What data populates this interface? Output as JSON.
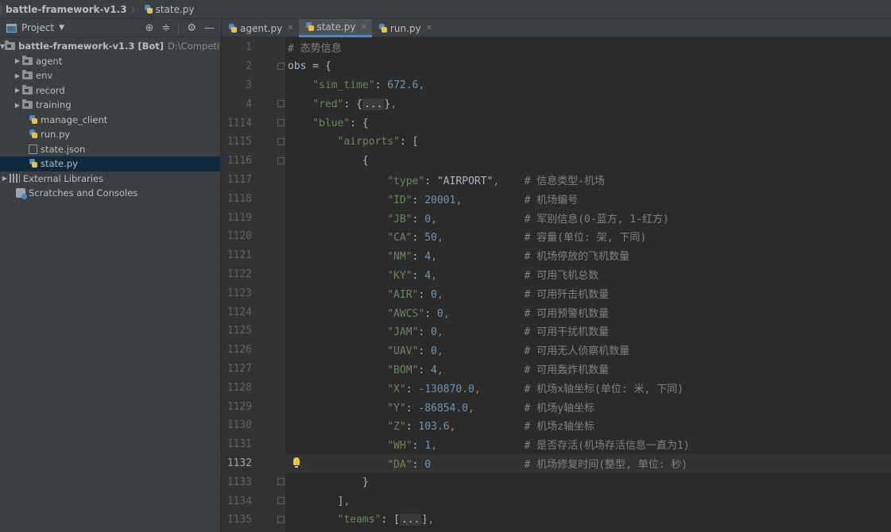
{
  "breadcrumb": {
    "project": "battle-framework-v1.3",
    "file": "state.py"
  },
  "project_panel": {
    "title": "Project",
    "root": {
      "name": "battle-framework-v1.3 [Bot]",
      "path": "D:\\Competition\\兵"
    },
    "items": [
      {
        "label": "agent",
        "kind": "folder"
      },
      {
        "label": "env",
        "kind": "folder"
      },
      {
        "label": "record",
        "kind": "folder"
      },
      {
        "label": "training",
        "kind": "folder"
      },
      {
        "label": "manage_client",
        "kind": "py"
      },
      {
        "label": "run.py",
        "kind": "py"
      },
      {
        "label": "state.json",
        "kind": "json"
      },
      {
        "label": "state.py",
        "kind": "py",
        "selected": true
      }
    ],
    "external": "External Libraries",
    "scratches": "Scratches and Consoles"
  },
  "tabs": [
    {
      "label": "agent.py",
      "active": false
    },
    {
      "label": "state.py",
      "active": true
    },
    {
      "label": "run.py",
      "active": false
    }
  ],
  "editor": {
    "current_line": "1132",
    "lines": [
      {
        "n": "1",
        "code": "# 态势信息"
      },
      {
        "n": "2",
        "code": "obs = {"
      },
      {
        "n": "3",
        "code": "    \"sim_time\": 672.6,"
      },
      {
        "n": "4",
        "code": "    \"red\": {...},"
      },
      {
        "n": "1114",
        "code": "    \"blue\": {"
      },
      {
        "n": "1115",
        "code": "        \"airports\": ["
      },
      {
        "n": "1116",
        "code": "            {"
      },
      {
        "n": "1117",
        "code": "                \"type\": \"AIRPORT\",    # 信息类型-机场"
      },
      {
        "n": "1118",
        "code": "                \"ID\": 20001,          # 机场编号"
      },
      {
        "n": "1119",
        "code": "                \"JB\": 0,              # 军别信息(0-蓝方, 1-红方)"
      },
      {
        "n": "1120",
        "code": "                \"CA\": 50,             # 容量(单位: 架, 下同)"
      },
      {
        "n": "1121",
        "code": "                \"NM\": 4,              # 机场停放的飞机数量"
      },
      {
        "n": "1122",
        "code": "                \"KY\": 4,              # 可用飞机总数"
      },
      {
        "n": "1123",
        "code": "                \"AIR\": 0,             # 可用歼击机数量"
      },
      {
        "n": "1124",
        "code": "                \"AWCS\": 0,            # 可用预警机数量"
      },
      {
        "n": "1125",
        "code": "                \"JAM\": 0,             # 可用干扰机数量"
      },
      {
        "n": "1126",
        "code": "                \"UAV\": 0,             # 可用无人侦察机数量"
      },
      {
        "n": "1127",
        "code": "                \"BOM\": 4,             # 可用轰炸机数量"
      },
      {
        "n": "1128",
        "code": "                \"X\": -130870.0,       # 机场x轴坐标(单位: 米, 下同)"
      },
      {
        "n": "1129",
        "code": "                \"Y\": -86854.0,        # 机场y轴坐标"
      },
      {
        "n": "1130",
        "code": "                \"Z\": 103.6,           # 机场z轴坐标"
      },
      {
        "n": "1131",
        "code": "                \"WH\": 1,              # 是否存活(机场存活信息一直为1)"
      },
      {
        "n": "1132",
        "code": "                \"DA\": 0               # 机场修复时间(整型, 单位: 秒)"
      },
      {
        "n": "1133",
        "code": "            }"
      },
      {
        "n": "1134",
        "code": "        ],"
      },
      {
        "n": "1135",
        "code": "        \"teams\": [...],"
      }
    ]
  }
}
